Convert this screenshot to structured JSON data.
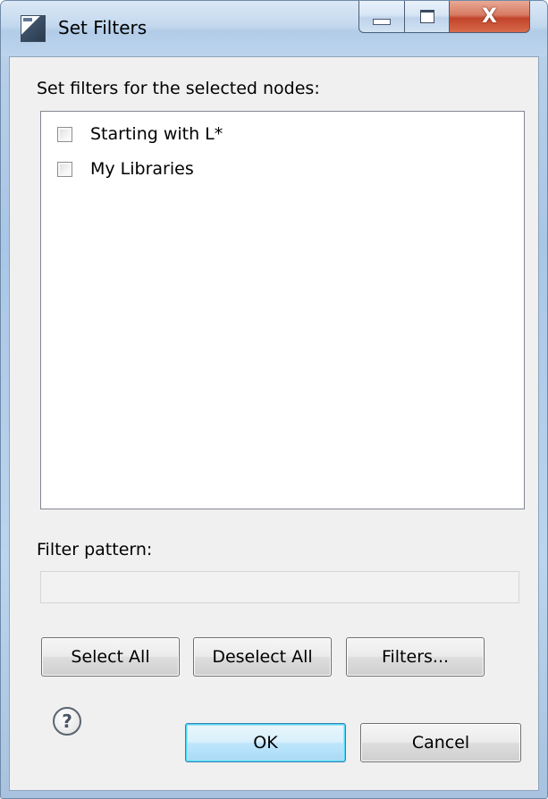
{
  "window": {
    "title": "Set Filters",
    "close_glyph": "X"
  },
  "main": {
    "instruction_label": "Set filters for the selected nodes:",
    "nodes": [
      {
        "label": "Starting with L*",
        "checked": false
      },
      {
        "label": "My Libraries",
        "checked": false
      }
    ],
    "filter_pattern_label": "Filter pattern:",
    "filter_pattern_value": ""
  },
  "buttons": {
    "select_all": "Select All",
    "deselect_all": "Deselect All",
    "filters": "Filters...",
    "ok": "OK",
    "cancel": "Cancel"
  },
  "icons": {
    "help": "help-icon",
    "help_glyph": "?"
  }
}
